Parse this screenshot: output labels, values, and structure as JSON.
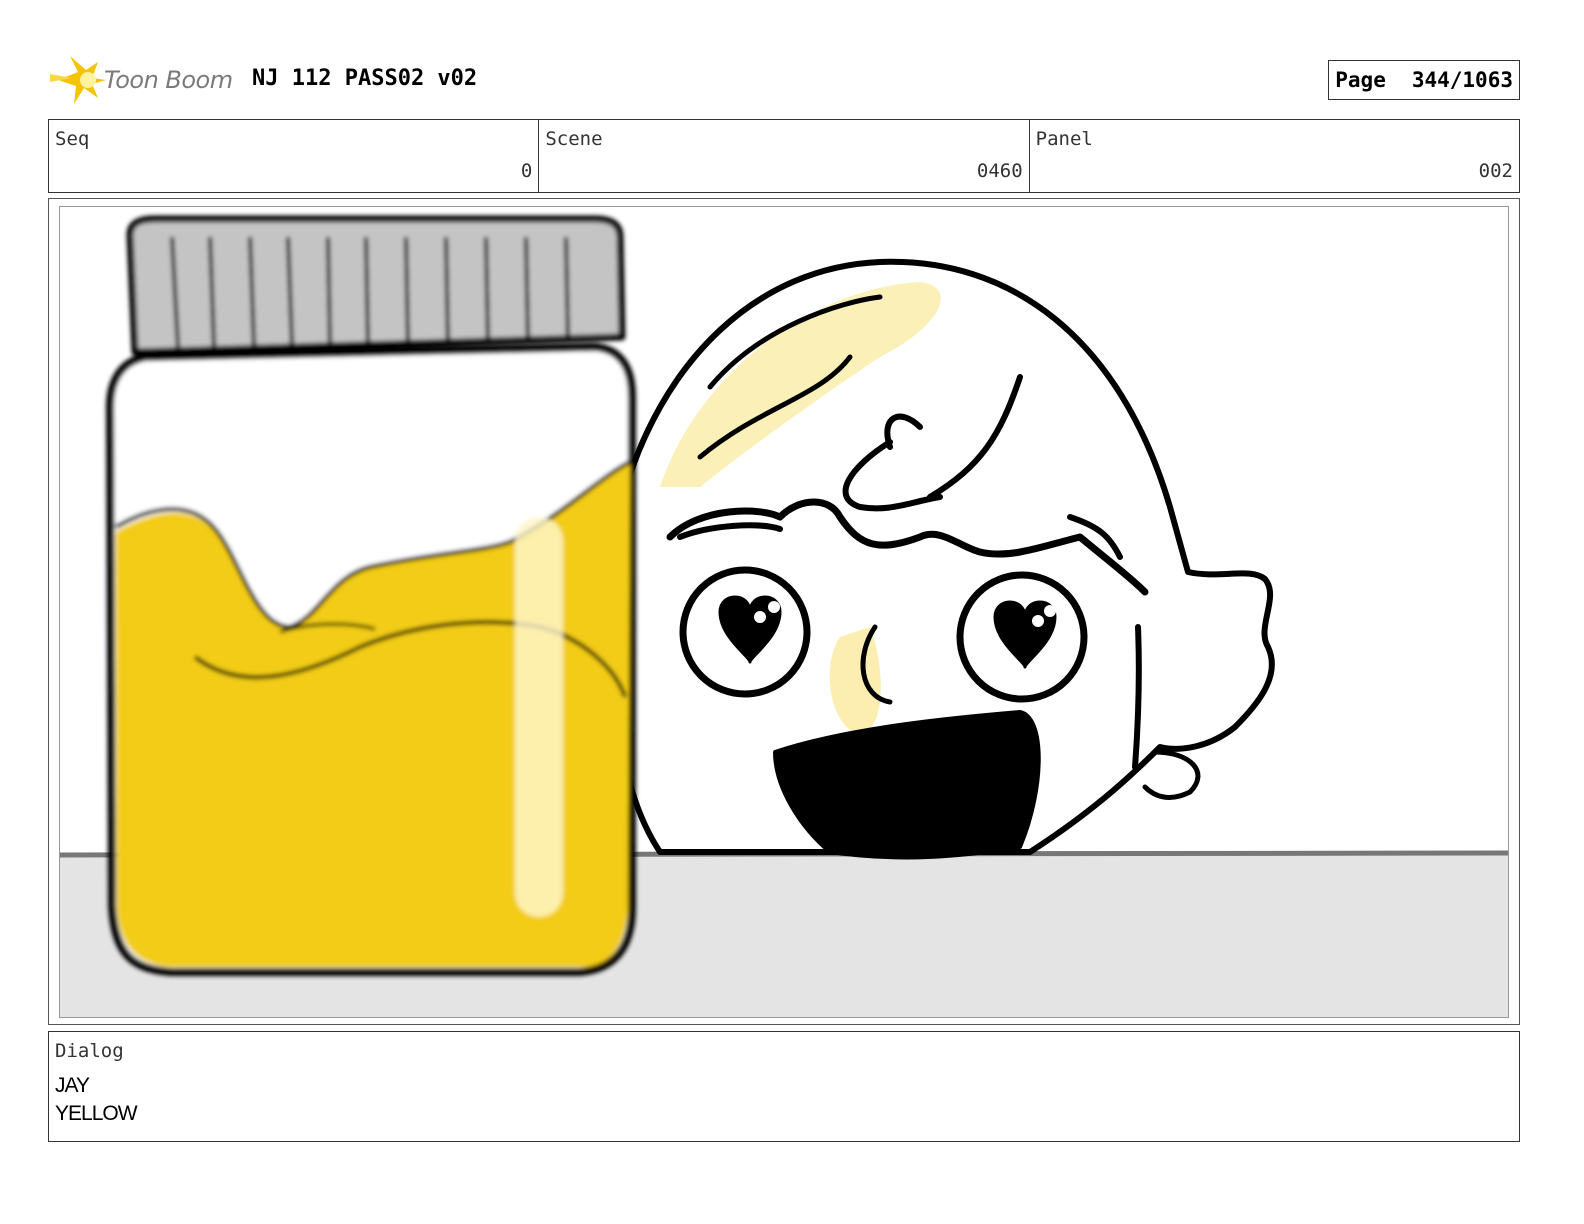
{
  "header": {
    "logo_text": "Toon Boom",
    "project_title": "NJ 112 PASS02 v02",
    "page_label": "Page",
    "page_number": "344/1063"
  },
  "info": {
    "seq_label": "Seq",
    "seq_value": "0",
    "scene_label": "Scene",
    "scene_value": "0460",
    "panel_label": "Panel",
    "panel_value": "002"
  },
  "dialog": {
    "label": "Dialog",
    "lines": [
      "JAY",
      "YELLOW"
    ]
  },
  "colors": {
    "jar_fill": "#f2cc12",
    "jar_lid": "#c4c4c4",
    "floor": "#e4e4e4",
    "hair_tint": "#fbeeb0",
    "logo_star": "#f5c400"
  }
}
